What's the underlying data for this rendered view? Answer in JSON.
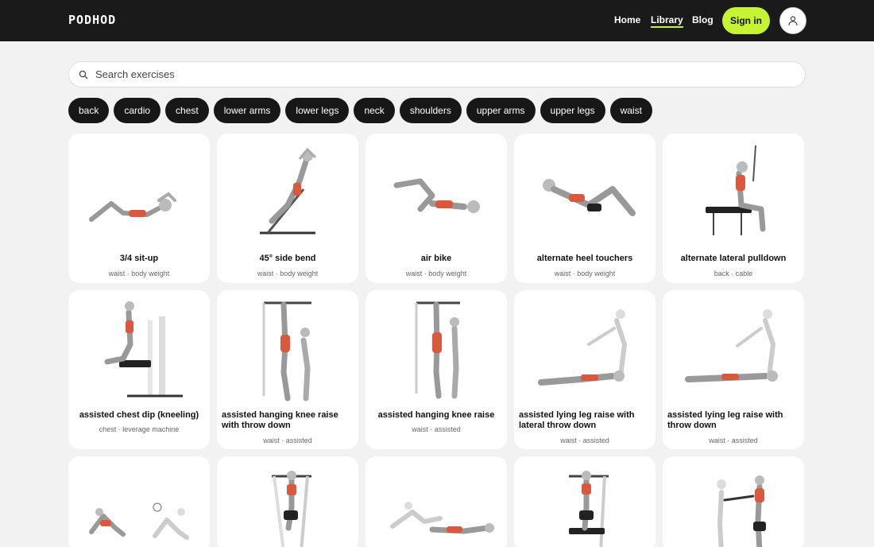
{
  "brand": "PODHOD",
  "nav": {
    "home": "Home",
    "library": "Library",
    "blog": "Blog",
    "signin": "Sign in"
  },
  "search": {
    "placeholder": "Search exercises"
  },
  "chips": [
    "back",
    "cardio",
    "chest",
    "lower arms",
    "lower legs",
    "neck",
    "shoulders",
    "upper arms",
    "upper legs",
    "waist"
  ],
  "accent_color": "#c6f432",
  "cards": [
    {
      "title": "3/4 sit-up",
      "meta": "waist · body weight"
    },
    {
      "title": "45° side bend",
      "meta": "waist · body weight"
    },
    {
      "title": "air bike",
      "meta": "waist · body weight"
    },
    {
      "title": "alternate heel touchers",
      "meta": "waist · body weight"
    },
    {
      "title": "alternate lateral pulldown",
      "meta": "back · cable"
    },
    {
      "title": "assisted chest dip (kneeling)",
      "meta": "chest · leverage machine"
    },
    {
      "title": "assisted hanging knee raise with throw down",
      "meta": "waist · assisted"
    },
    {
      "title": "assisted hanging knee raise",
      "meta": "waist · assisted"
    },
    {
      "title": "assisted lying leg raise with lateral throw down",
      "meta": "waist · assisted"
    },
    {
      "title": "assisted lying leg raise with throw down",
      "meta": "waist · assisted"
    },
    {
      "title": "",
      "meta": ""
    },
    {
      "title": "",
      "meta": ""
    },
    {
      "title": "",
      "meta": ""
    },
    {
      "title": "",
      "meta": ""
    },
    {
      "title": "",
      "meta": ""
    }
  ]
}
